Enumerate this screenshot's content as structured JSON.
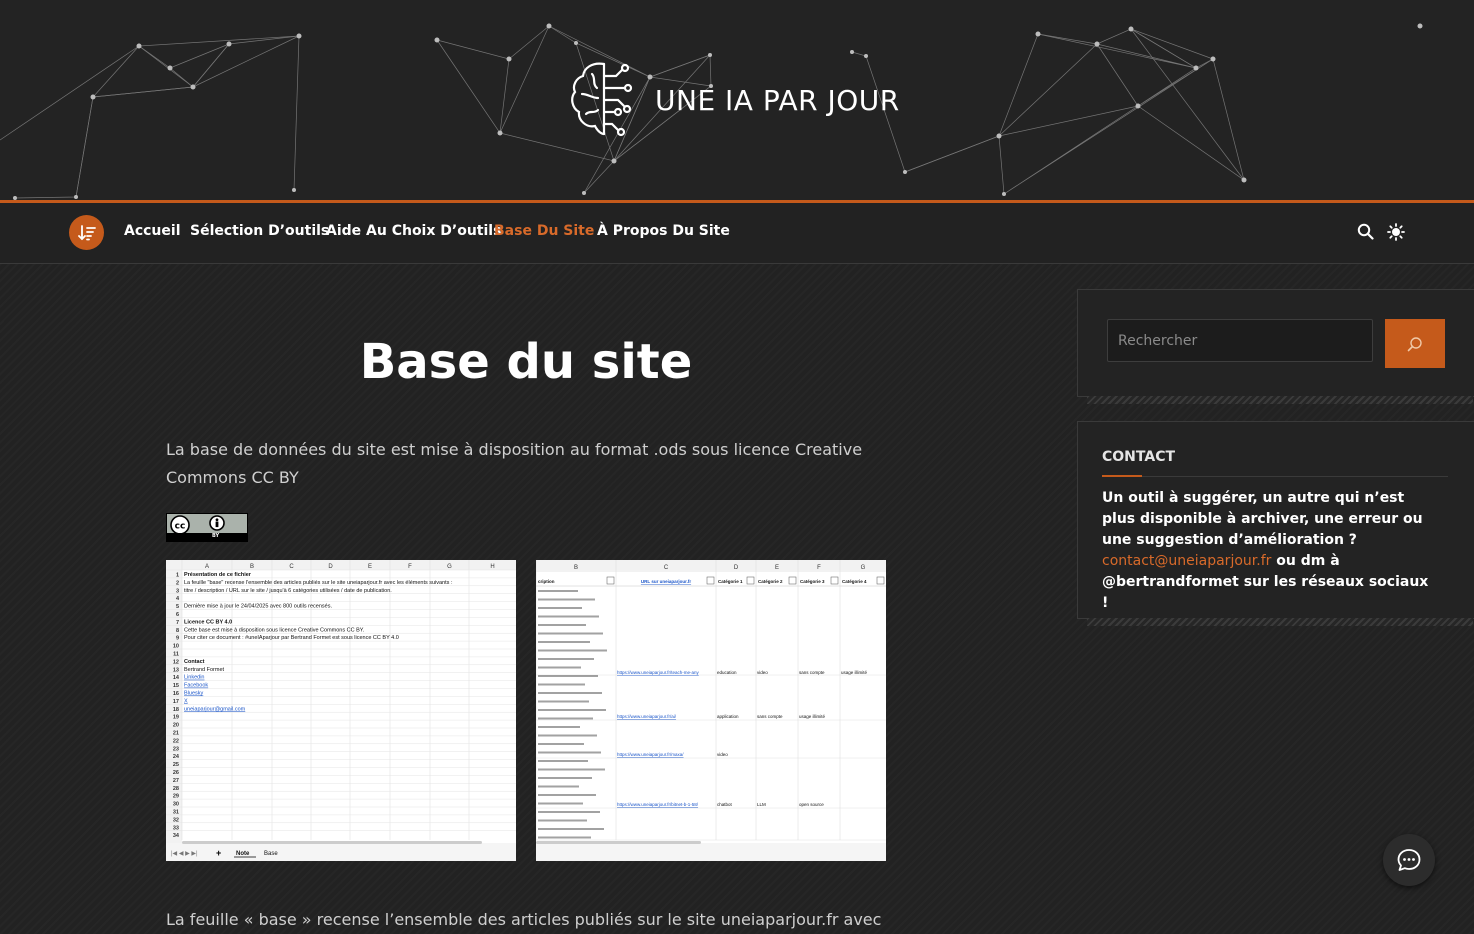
{
  "site": {
    "title": "UNE IA PAR JOUR"
  },
  "nav": {
    "items": [
      {
        "label": "Accueil"
      },
      {
        "label": "Sélection D’outils"
      },
      {
        "label": "Aide Au Choix D’outils"
      },
      {
        "label": "Base Du Site"
      },
      {
        "label": "À Propos Du Site"
      }
    ],
    "active": "Base Du Site"
  },
  "page": {
    "title": "Base du site",
    "intro": "La base de données du site est mise à disposition au format .ods sous licence Creative Commons CC BY",
    "bottom_text": "La feuille « base » recense l’ensemble des articles publiés sur le site uneiaparjour.fr avec",
    "badge_label": "BY"
  },
  "sheet1": {
    "columns": [
      "A",
      "B",
      "C",
      "D",
      "E",
      "F",
      "G",
      "H"
    ],
    "rows": [
      "Présentation de ce fichier",
      "La feuille \"base\" recense l'ensemble des articles publiés sur le site uneiaparjour.fr avec les éléments suivants :",
      "titre / description / URL sur le site / jusqu'à 6 catégories utilisées / date de publication.",
      "",
      "Dernière mise à jour le 24/04/2025 avec 800 outils recensés.",
      "",
      "Licence CC BY 4.0",
      "Cette base est mise à disposition sous licence Creative Commons CC BY.",
      "Pour citer ce document : #uneIAparjour par Bertrand Formet est sous licence CC BY 4.0",
      "",
      "",
      "Contact",
      "Bertrand Formet",
      "Linkedin",
      "Facebook",
      "Bluesky",
      "X",
      "uneiaparjour@gmail.com"
    ],
    "tabs": [
      "Note",
      "Base"
    ]
  },
  "sheet2": {
    "columns": [
      "B",
      "C",
      "D",
      "E",
      "F",
      "G"
    ],
    "headers": [
      "cription",
      "URL sur uneiaparjour.fr",
      "Catégorie 1",
      "Catégorie 2",
      "Catégorie 3",
      "Catégorie 4"
    ],
    "rows": [
      [
        "",
        "https://www.uneiaparjour.fr/teach-me-any",
        "education",
        "video",
        "sans compte",
        "usage illimité"
      ],
      [
        "",
        "https://www.uneiaparjour.fr/ai/",
        "application",
        "sans compte",
        "usage illimité",
        ""
      ],
      [
        "",
        "https://www.uneiaparjour.fr/maxa/",
        "video",
        "",
        "",
        ""
      ],
      [
        "",
        "https://www.uneiaparjour.fr/bitnet-b-1-58/",
        "chatbot",
        "LLM",
        "open source",
        ""
      ]
    ]
  },
  "sidebar": {
    "search_placeholder": "Rechercher",
    "contact_title": "CONTACT",
    "contact_text_1": "Un outil à suggérer, un autre qui n’est plus disponible à archiver, une erreur ou une suggestion d’amélioration ?",
    "contact_email": "contact@uneiaparjour.fr",
    "contact_text_2": " ou dm à @bertrandformet sur les réseaux sociaux !"
  },
  "colors": {
    "accent": "#c55a1b",
    "background": "#222222",
    "link": "#d86a2a"
  },
  "icons": [
    "brain-logo-icon",
    "sort-menu-icon",
    "search-icon",
    "sun-icon",
    "chat-icon"
  ]
}
